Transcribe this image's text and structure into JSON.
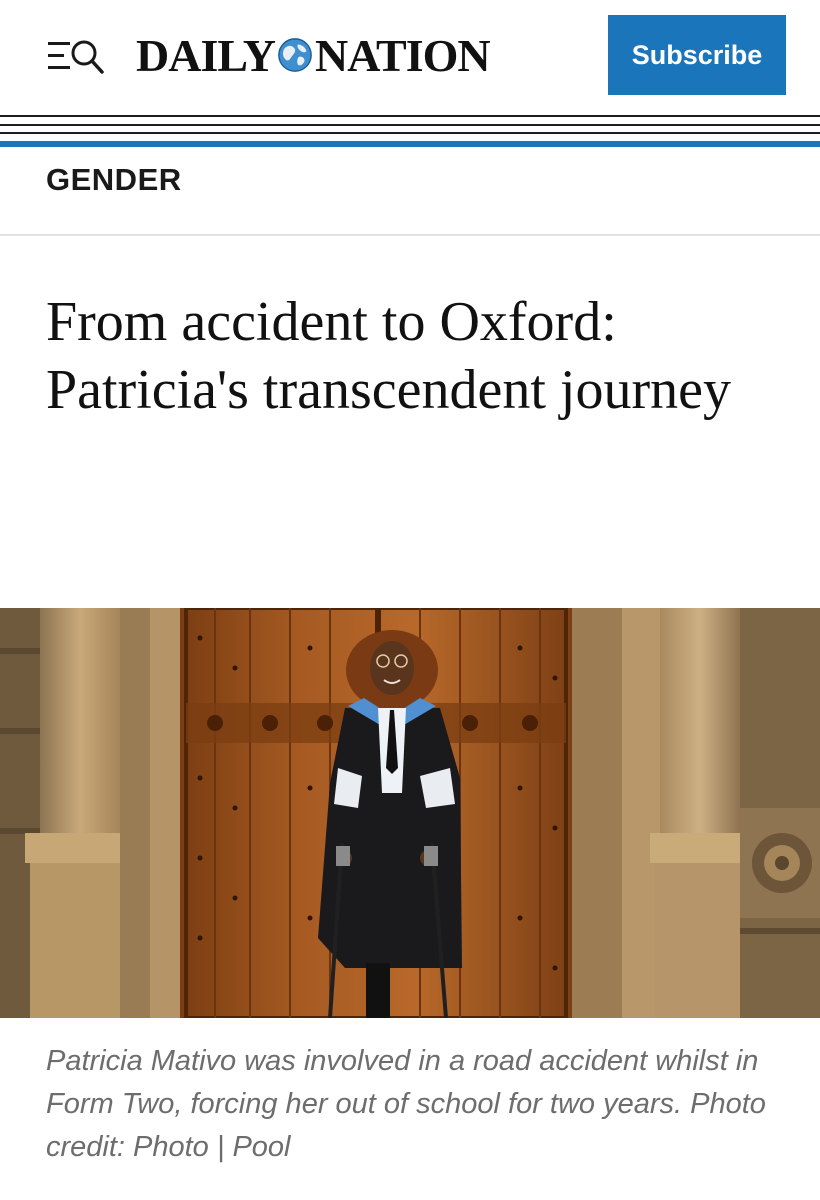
{
  "header": {
    "logo_left": "DAILY",
    "logo_right": "NATION",
    "subscribe_label": "Subscribe",
    "menu_icon": "menu-icon",
    "search_icon": "search-icon",
    "brand_color": "#1a75bb"
  },
  "section": {
    "label": "GENDER"
  },
  "article": {
    "headline": "From accident to Oxford: Patricia's transcendent journey",
    "image_alt": "Patricia Mativo in graduation gown standing on crutches before a wooden door",
    "caption": "Patricia Mativo was involved in a road accident whilst in Form Two, forcing her out of school for two years.  Photo credit: Photo | Pool"
  }
}
